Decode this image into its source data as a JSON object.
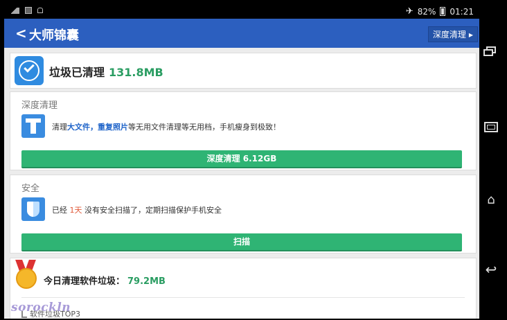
{
  "statusbar": {
    "battery": "82%",
    "time": "01:21",
    "icons": [
      "notification-icon",
      "image-icon",
      "lock-icon",
      "airplane-icon",
      "battery-icon"
    ]
  },
  "header": {
    "back_icon": "chevron-left-icon",
    "title": "大师锦囊",
    "right_button": "深度清理"
  },
  "summary": {
    "label": "垃圾已清理",
    "amount": "131.8MB",
    "icon": "check-circle-icon"
  },
  "deep_clean": {
    "section_title": "深度清理",
    "icon": "broom-icon",
    "desc_prefix": "清理",
    "desc_hl1": "大文件",
    "desc_sep": "，",
    "desc_hl2": "重复照片",
    "desc_suffix": "等无用文件清理等无用档，手机瘦身到极致！",
    "button": "深度清理 6.12GB"
  },
  "security": {
    "section_title": "安全",
    "icon": "shield-icon",
    "desc_prefix": "已经",
    "desc_days": "1天",
    "desc_suffix": "没有安全扫描了，定期扫描保护手机安全",
    "button": "扫描"
  },
  "today": {
    "icon": "medal-icon",
    "label": "今日清理软件垃圾：",
    "amount": "79.2MB",
    "top3": "软件垃圾TOP3"
  },
  "watermark": "sorockln",
  "colors": {
    "header": "#2c5fbf",
    "accent_green": "#2fb474",
    "amount_green": "#2a9d62",
    "highlight_blue": "#1e63c9",
    "highlight_red": "#e05a3a"
  }
}
